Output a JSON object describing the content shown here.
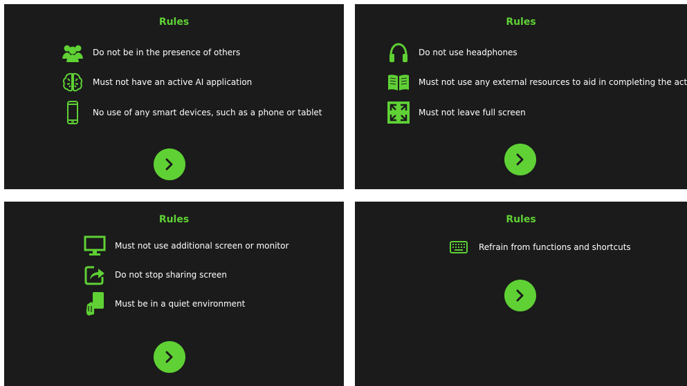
{
  "accent_color": "#5fd135",
  "background_color": "#1b1b1b",
  "panels": [
    {
      "title": "Rules",
      "rules": [
        {
          "icon": "people-icon",
          "text": "Do not be in the presence of others"
        },
        {
          "icon": "brain-icon",
          "text": "Must not have an active AI application"
        },
        {
          "icon": "smartphone-icon",
          "text": "No use of any smart devices, such as a phone or tablet"
        }
      ],
      "next_icon": "chevron-right-icon"
    },
    {
      "title": "Rules",
      "rules": [
        {
          "icon": "headphones-icon",
          "text": "Do not use headphones"
        },
        {
          "icon": "book-icon",
          "text": "Must not use any external resources to aid in completing the activity"
        },
        {
          "icon": "fullscreen-icon",
          "text": "Must not leave full screen"
        }
      ],
      "next_icon": "chevron-right-icon"
    },
    {
      "title": "Rules",
      "rules": [
        {
          "icon": "monitor-icon",
          "text": "Must not use additional screen or monitor"
        },
        {
          "icon": "share-icon",
          "text": "Do not stop sharing screen"
        },
        {
          "icon": "hand-shush-icon",
          "text": "Must be in a quiet environment"
        }
      ],
      "next_icon": "chevron-right-icon"
    },
    {
      "title": "Rules",
      "rules": [
        {
          "icon": "keyboard-icon",
          "text": "Refrain from functions and shortcuts"
        }
      ],
      "next_icon": "chevron-right-icon"
    }
  ]
}
